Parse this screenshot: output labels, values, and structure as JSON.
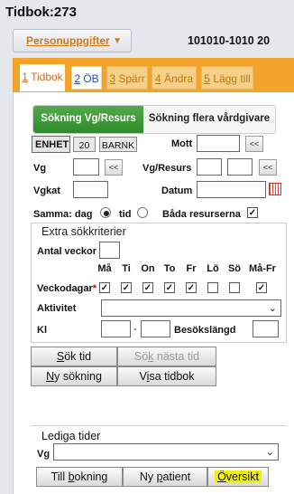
{
  "title": "Tidbok:273",
  "header": {
    "person_menu": "Personuppgifter",
    "patient_id": "101010-1010 20"
  },
  "tabs": [
    {
      "num": "1",
      "label": "Tidbok"
    },
    {
      "num": "2",
      "label": "ÖB"
    },
    {
      "num": "3",
      "label": "Spärr"
    },
    {
      "num": "4",
      "label": "Ändra"
    },
    {
      "num": "5",
      "label": "Lägg till"
    }
  ],
  "segment": {
    "left": "Sökning Vg/Resurs",
    "right": "Sökning flera vårdgivare"
  },
  "form": {
    "enhet_label": "ENHET",
    "enhet_code": "20",
    "enhet_name": "BARNK",
    "mott_label": "Mott",
    "vg_label": "Vg",
    "vgresurs_label": "Vg/Resurs",
    "vgkat_label": "Vgkat",
    "datum_label": "Datum",
    "samma_label": "Samma: dag",
    "tid_label": "tid",
    "bada_label": "Båda resurserna",
    "lookup_button": "<<"
  },
  "extra": {
    "title": "Extra sökkriterier",
    "antal_label": "Antal veckor",
    "days": [
      "Må",
      "Ti",
      "On",
      "To",
      "Fr",
      "Lö",
      "Sö",
      "Må-Fr"
    ],
    "days_checked": [
      true,
      true,
      true,
      true,
      true,
      false,
      false,
      true
    ],
    "veckodagar_label": "Veckodagar",
    "required_mark": "*",
    "aktivitet_label": "Aktivitet",
    "kl_label": "Kl",
    "kl_sep": "-",
    "besok_label": "Besökslängd"
  },
  "buttons": {
    "sok_tid_u": "S",
    "sok_tid_rest": "ök tid",
    "sok_nasta_a": "Sö",
    "sok_nasta_u": "k",
    "sok_nasta_b": " nästa tid",
    "ny_a": "N",
    "ny_b": "y sökning",
    "visa_a": "V",
    "visa_u": "i",
    "visa_b": "sa tidbok"
  },
  "lediga": {
    "title": "Lediga tider",
    "vg_label": "Vg",
    "till_a": "Till ",
    "till_u": "b",
    "till_b": "okning",
    "ny_patient_a": "Ny ",
    "ny_patient_u": "p",
    "ny_patient_b": "atient",
    "oversikt_u": "Ö",
    "oversikt_rest": "versikt"
  },
  "colors": {
    "accent_orange": "#f4a32a",
    "green": "#3a9a35",
    "highlight": "#f2f20a"
  }
}
